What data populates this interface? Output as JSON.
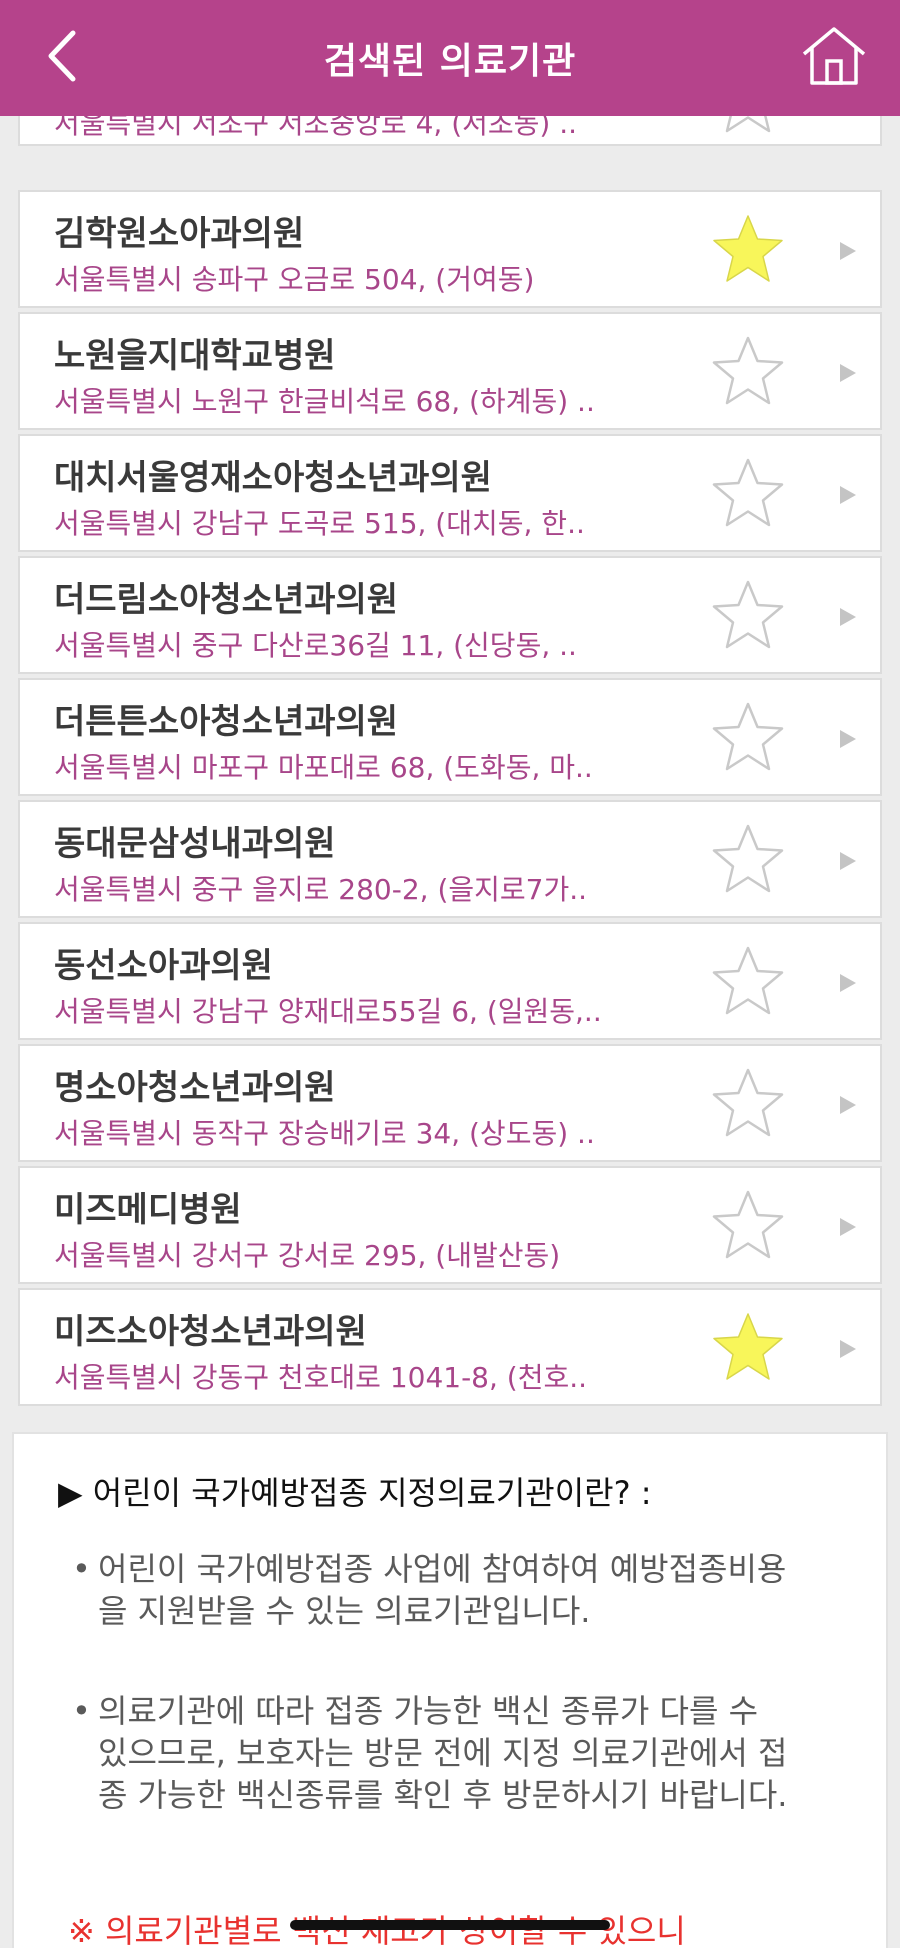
{
  "header": {
    "title": "검색된 의료기관",
    "back_icon": "chevron-left-icon",
    "home_icon": "home-icon",
    "background": "#b5438b"
  },
  "clinics": [
    {
      "name": "",
      "address": "서울특별시 서초구 서초중앙로 4, (서초동) ..",
      "favorite": false
    },
    {
      "name": "김학원소아과의원",
      "address": "서울특별시 송파구 오금로 504, (거여동)",
      "favorite": true
    },
    {
      "name": "노원을지대학교병원",
      "address": "서울특별시 노원구 한글비석로 68, (하계동) ..",
      "favorite": false
    },
    {
      "name": "대치서울영재소아청소년과의원",
      "address": "서울특별시 강남구 도곡로 515, (대치동, 한..",
      "favorite": false
    },
    {
      "name": "더드림소아청소년과의원",
      "address": "서울특별시 중구 다산로36길 11, (신당동, ..",
      "favorite": false
    },
    {
      "name": "더튼튼소아청소년과의원",
      "address": "서울특별시 마포구 마포대로 68, (도화동, 마..",
      "favorite": false
    },
    {
      "name": "동대문삼성내과의원",
      "address": "서울특별시 중구 을지로 280-2, (을지로7가..",
      "favorite": false
    },
    {
      "name": "동선소아과의원",
      "address": "서울특별시 강남구 양재대로55길 6, (일원동,..",
      "favorite": false
    },
    {
      "name": "명소아청소년과의원",
      "address": "서울특별시 동작구 장승배기로 34, (상도동) ..",
      "favorite": false
    },
    {
      "name": "미즈메디병원",
      "address": "서울특별시 강서구 강서로 295, (내발산동)",
      "favorite": false
    },
    {
      "name": "미즈소아청소년과의원",
      "address": "서울특별시 강동구 천호대로 1041-8, (천호..",
      "favorite": true
    }
  ],
  "info": {
    "heading": "▶ 어린이 국가예방접종 지정의료기관이란? :",
    "bullet_marker": "•",
    "bullets": [
      "어린이 국가예방접종 사업에 참여하여 예방접종비용을 지원받을 수 있는 의료기관입니다.",
      "의료기관에 따라 접종 가능한 백신 종류가 다를 수 있으므로, 보호자는 방문 전에 지정 의료기관에서 접종 가능한 백신종류를 확인 후 방문하시기 바랍니다."
    ],
    "notice": "※ 의료기관별로 백신 재고가 상이할 수 있으니"
  },
  "colors": {
    "accent": "#b5438b",
    "address_text": "#a8468a",
    "favorite_star": "#f8f65a",
    "notice_text": "#e8322f"
  }
}
